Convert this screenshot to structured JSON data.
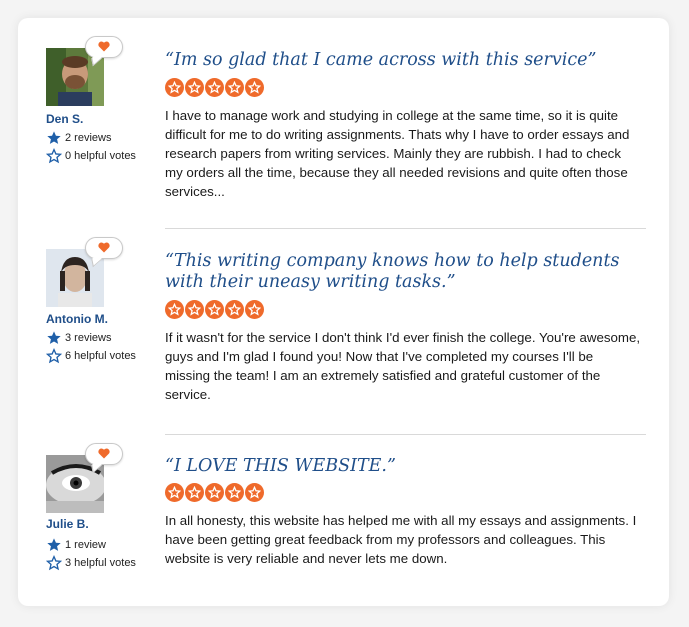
{
  "reviews": [
    {
      "name": "Den S.",
      "reviews_count": "2 reviews",
      "helpful_votes": "0 helpful votes",
      "title": "“Im so glad that I came across with this service”",
      "rating": 5,
      "text": "I have to manage work and studying in college at the same time, so it is quite difficult for me to do writing assignments. Thats why I have to order essays and research papers from writing services. Mainly they are rubbish. I had to check my orders all the time, because they all needed revisions and quite often those services..."
    },
    {
      "name": "Antonio M.",
      "reviews_count": "3 reviews",
      "helpful_votes": "6 helpful votes",
      "title": "“This writing company knows how to help students with their uneasy writing tasks.”",
      "rating": 5,
      "text": "If it wasn't for the service I don't think I'd ever finish the college. You're awesome, guys and I'm glad I found you! Now that I've completed my courses I'll be missing the team! I am an extremely satisfied and grateful customer of the service."
    },
    {
      "name": "Julie B.",
      "reviews_count": "1 review",
      "helpful_votes": "3 helpful votes",
      "title": "“I LOVE THIS WEBSITE.”",
      "rating": 5,
      "text": "In all honesty, this website has helped me with all my essays and assignments. I have been getting great feedback from my professors and colleagues. This website is very reliable and never lets me down."
    }
  ],
  "colors": {
    "accent_blue": "#1f4e89",
    "star_orange": "#ef6a2b",
    "heart_orange": "#ef6a2b"
  },
  "icons": {
    "heart": "heart-icon",
    "reviews": "star-icon",
    "helpful": "star-outline-icon"
  }
}
